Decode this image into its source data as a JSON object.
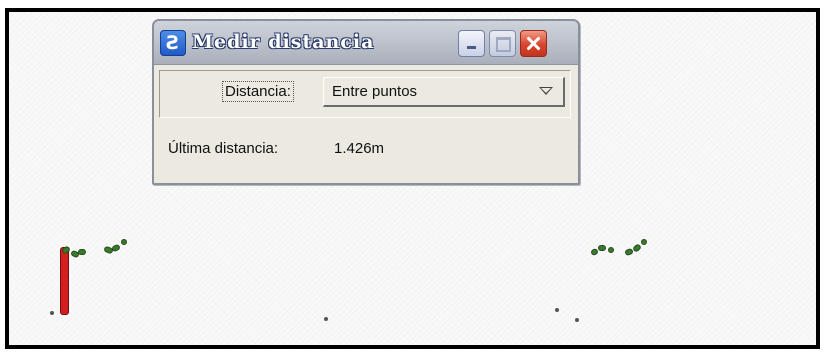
{
  "window": {
    "title": "Medir distancia",
    "icon": "microstation-app-icon",
    "icon_glyph": "Ƨ",
    "controls": [
      "minimize",
      "maximize",
      "close"
    ]
  },
  "dialog": {
    "distance_label": "Distancia:",
    "distance_mode": "Entre puntos",
    "last_distance_label": "Última distancia:",
    "last_distance_value": "1.426m"
  },
  "colors": {
    "close_button": "#d8452f",
    "post": "#d22020",
    "vegetation": "#3a7a2c"
  }
}
